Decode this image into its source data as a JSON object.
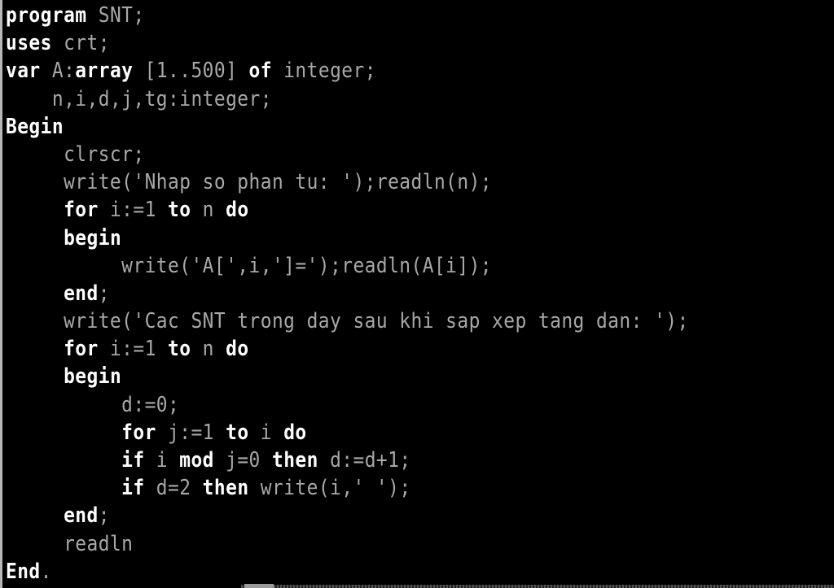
{
  "editor": {
    "language": "Pascal",
    "colors": {
      "background": "#000000",
      "keyword": "#ffffff",
      "identifier": "#a8a8a8"
    },
    "lines": [
      [
        {
          "t": "program",
          "k": 1
        },
        {
          "t": " SNT;",
          "k": 0
        }
      ],
      [
        {
          "t": "uses",
          "k": 1
        },
        {
          "t": " crt;",
          "k": 0
        }
      ],
      [
        {
          "t": "var",
          "k": 1
        },
        {
          "t": " A:",
          "k": 0
        },
        {
          "t": "array",
          "k": 1
        },
        {
          "t": " [1..500] ",
          "k": 0
        },
        {
          "t": "of",
          "k": 1
        },
        {
          "t": " integer;",
          "k": 0
        }
      ],
      [
        {
          "t": "    n,i,d,j,tg:integer;",
          "k": 0
        }
      ],
      [
        {
          "t": "Begin",
          "k": 1
        }
      ],
      [
        {
          "t": "     clrscr;",
          "k": 0
        }
      ],
      [
        {
          "t": "     write('Nhap so phan tu: ');readln(n);",
          "k": 0
        }
      ],
      [
        {
          "t": "     ",
          "k": 0
        },
        {
          "t": "for",
          "k": 1
        },
        {
          "t": " i:=1 ",
          "k": 0
        },
        {
          "t": "to",
          "k": 1
        },
        {
          "t": " n ",
          "k": 0
        },
        {
          "t": "do",
          "k": 1
        }
      ],
      [
        {
          "t": "     ",
          "k": 0
        },
        {
          "t": "begin",
          "k": 1
        }
      ],
      [
        {
          "t": "          write('A[',i,']=');readln(A[i]);",
          "k": 0
        }
      ],
      [
        {
          "t": "     ",
          "k": 0
        },
        {
          "t": "end",
          "k": 1
        },
        {
          "t": ";",
          "k": 0
        }
      ],
      [
        {
          "t": "     write('Cac SNT trong day sau khi sap xep tang dan: ');",
          "k": 0
        }
      ],
      [
        {
          "t": "     ",
          "k": 0
        },
        {
          "t": "for",
          "k": 1
        },
        {
          "t": " i:=1 ",
          "k": 0
        },
        {
          "t": "to",
          "k": 1
        },
        {
          "t": " n ",
          "k": 0
        },
        {
          "t": "do",
          "k": 1
        }
      ],
      [
        {
          "t": "     ",
          "k": 0
        },
        {
          "t": "begin",
          "k": 1
        }
      ],
      [
        {
          "t": "          d:=0;",
          "k": 0
        }
      ],
      [
        {
          "t": "          ",
          "k": 0
        },
        {
          "t": "for",
          "k": 1
        },
        {
          "t": " j:=1 ",
          "k": 0
        },
        {
          "t": "to",
          "k": 1
        },
        {
          "t": " i ",
          "k": 0
        },
        {
          "t": "do",
          "k": 1
        }
      ],
      [
        {
          "t": "          ",
          "k": 0
        },
        {
          "t": "if",
          "k": 1
        },
        {
          "t": " i ",
          "k": 0
        },
        {
          "t": "mod",
          "k": 1
        },
        {
          "t": " j=0 ",
          "k": 0
        },
        {
          "t": "then",
          "k": 1
        },
        {
          "t": " d:=d+1;",
          "k": 0
        }
      ],
      [
        {
          "t": "          ",
          "k": 0
        },
        {
          "t": "if",
          "k": 1
        },
        {
          "t": " d=2 ",
          "k": 0
        },
        {
          "t": "then",
          "k": 1
        },
        {
          "t": " write(i,' ');",
          "k": 0
        }
      ],
      [
        {
          "t": "     ",
          "k": 0
        },
        {
          "t": "end",
          "k": 1
        },
        {
          "t": ";",
          "k": 0
        }
      ],
      [
        {
          "t": "     readln",
          "k": 0
        }
      ],
      [
        {
          "t": "End",
          "k": 1
        },
        {
          "t": ".",
          "k": 0
        }
      ]
    ]
  }
}
